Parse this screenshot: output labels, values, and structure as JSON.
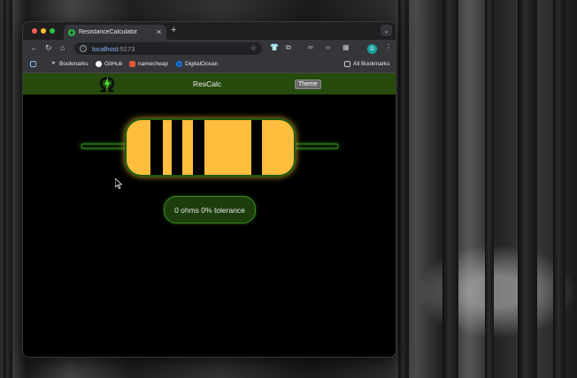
{
  "browser": {
    "tab_title": "ResistanceCalculator",
    "url_host": "localhost",
    "url_port": ":5173",
    "profile_initial": "D",
    "bookmarks": [
      {
        "label": "Bookmarks",
        "icon": "star-icon"
      },
      {
        "label": "GitHub",
        "icon": "github-icon"
      },
      {
        "label": "namecheap",
        "icon": "namecheap-icon"
      },
      {
        "label": "DigitalOcean",
        "icon": "digitalocean-icon"
      }
    ],
    "all_bookmarks_label": "All Bookmarks"
  },
  "app": {
    "title": "ResCalc",
    "theme_button": "Theme",
    "resistance_text": "0 ohms 0% tolerance",
    "colors": {
      "nav_bg": "#274a0d",
      "resistor_body": "#ffbe3c",
      "glow": "#3cd628",
      "band": "#000000"
    },
    "bands": [
      "black",
      "black",
      "black",
      "black"
    ]
  }
}
